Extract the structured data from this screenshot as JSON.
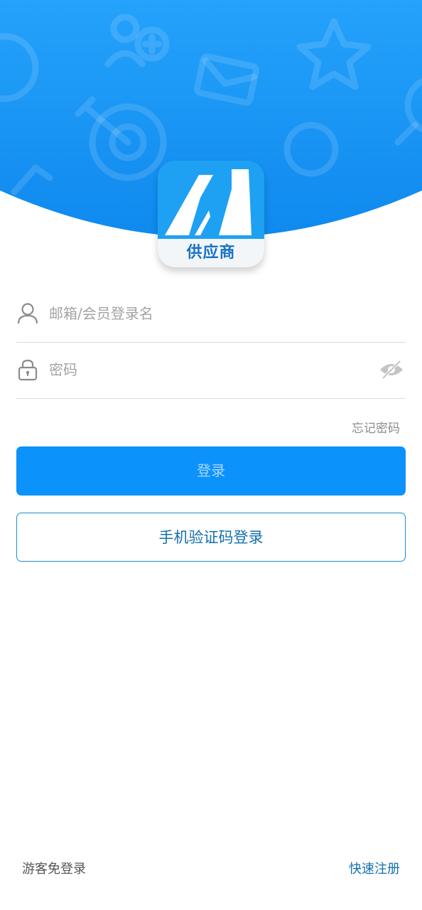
{
  "brand": {
    "logo_text": "供应商"
  },
  "login_form": {
    "account_placeholder": "邮箱/会员登录名",
    "password_placeholder": "密码",
    "forgot_password": "忘记密码",
    "login_button": "登录",
    "sms_login_button": "手机验证码登录"
  },
  "footer": {
    "guest_login": "游客免登录",
    "quick_register": "快速注册"
  },
  "icons": {
    "account": "user-icon",
    "password": "lock-icon",
    "toggle_password": "eye-off-icon"
  },
  "colors": {
    "header_blue": "#1a93f5",
    "primary_button": "#0b93fb",
    "link_blue": "#1470ad"
  }
}
